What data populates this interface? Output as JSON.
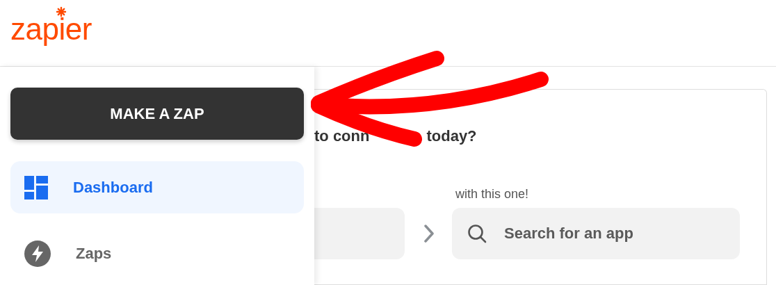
{
  "logo": {
    "text": "zapier"
  },
  "sidebar": {
    "make_button": "MAKE A ZAP",
    "items": [
      {
        "label": "Dashboard",
        "kind": "dashboard",
        "selected": true
      },
      {
        "label": "Zaps",
        "kind": "zap",
        "selected": false
      }
    ]
  },
  "main": {
    "heading_parts": [
      "to conn",
      "today?"
    ],
    "target_label": "with this one!",
    "target_search": {
      "placeholder": "Search for an app"
    }
  }
}
